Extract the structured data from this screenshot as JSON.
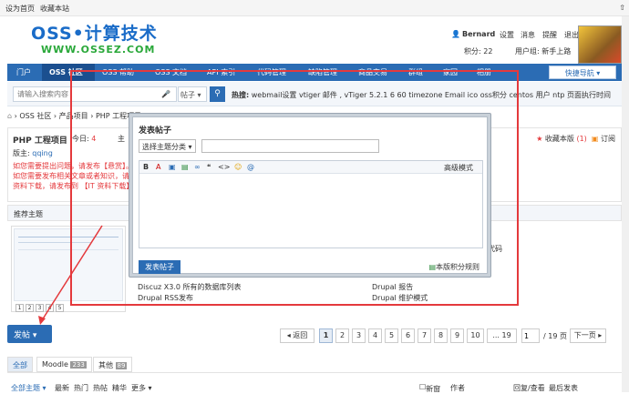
{
  "topbar": {
    "home": "设为首页",
    "bookmark": "收藏本站",
    "scroll_up": "⇧"
  },
  "logo": {
    "title": "OSS•计算技术",
    "sub": "WWW.OSSEZ.COM"
  },
  "user": {
    "name": "Bernard",
    "links": [
      "设置",
      "消息",
      "提醒",
      "退出"
    ],
    "points": "积分: 22",
    "group": "用户组: 新手上路"
  },
  "nav": {
    "items": [
      "门户",
      "OSS 社区",
      "OSS 帮助",
      "OSS 文档",
      "API 索引",
      "代码管理",
      "缺陷管理",
      "商品交易",
      "群组",
      "家园",
      "相册"
    ],
    "quick": "快捷导航 ▾"
  },
  "search": {
    "placeholder": "请输入搜索内容",
    "scope": "帖子 ▾",
    "hot_label": "热搜:",
    "hot": "webmail设置  vtiger  邮件 , vTiger  5.2.1  6  60  timezone  Email  ico  oss积分  centos  用户  ntp  页面执行时间"
  },
  "breadcrumb": {
    "items": [
      "OSS 社区",
      "产品项目",
      "PHP 工程项目"
    ]
  },
  "forum": {
    "title": "PHP 工程项目",
    "today_label": "今日:",
    "today_count": "4",
    "zhu": "主",
    "moderator_label": "版主:",
    "moderator": "qqing",
    "notices": [
      "如您需要提出问题，请发布【悬赏】。",
      "如您需要发布相关文章或者知识，请按照",
      "资料下载，请发布到 【IT 资料下载】版"
    ],
    "fav": "收藏本版",
    "fav_count": "(1)",
    "subscribe": "订阅"
  },
  "recommend": {
    "title": "推荐主题",
    "thumb_nums": [
      "1",
      "2",
      "3",
      "4",
      "5"
    ],
    "items_left": [
      "Discuz X3.0 所有的数据库列表",
      "Drupal RSS发布"
    ],
    "items_right": [
      "Drupal 报告",
      "Drupal 维护模式"
    ],
    "item_partial": "代码"
  },
  "post_btn": "发帖 ▾",
  "pager": {
    "back": "◂ 返回",
    "pages": [
      "1",
      "2",
      "3",
      "4",
      "5",
      "6",
      "7",
      "8",
      "9",
      "10",
      "... 19"
    ],
    "input": "1",
    "total": "/ 19 页",
    "next": "下一页 ▸"
  },
  "tabs": [
    {
      "label": "全部",
      "count": ""
    },
    {
      "label": "Moodle",
      "count": "233"
    },
    {
      "label": "其他",
      "count": "89"
    }
  ],
  "filter": {
    "items": [
      "全部主题 ▾",
      "最新",
      "热门",
      "热帖",
      "精华",
      "更多 ▾"
    ],
    "new_label": "新窗",
    "author": "作者",
    "reply": "回复/查看",
    "last": "最后发表"
  },
  "modal": {
    "title": "发表帖子",
    "type_sel": "选择主题分类 ▾",
    "toolbar": [
      "B",
      "A",
      "▣",
      "▤",
      "∞",
      "❝",
      "<>",
      "☺",
      "@"
    ],
    "advanced": "高级模式",
    "submit": "发表帖子",
    "rules": "本版积分规则"
  }
}
